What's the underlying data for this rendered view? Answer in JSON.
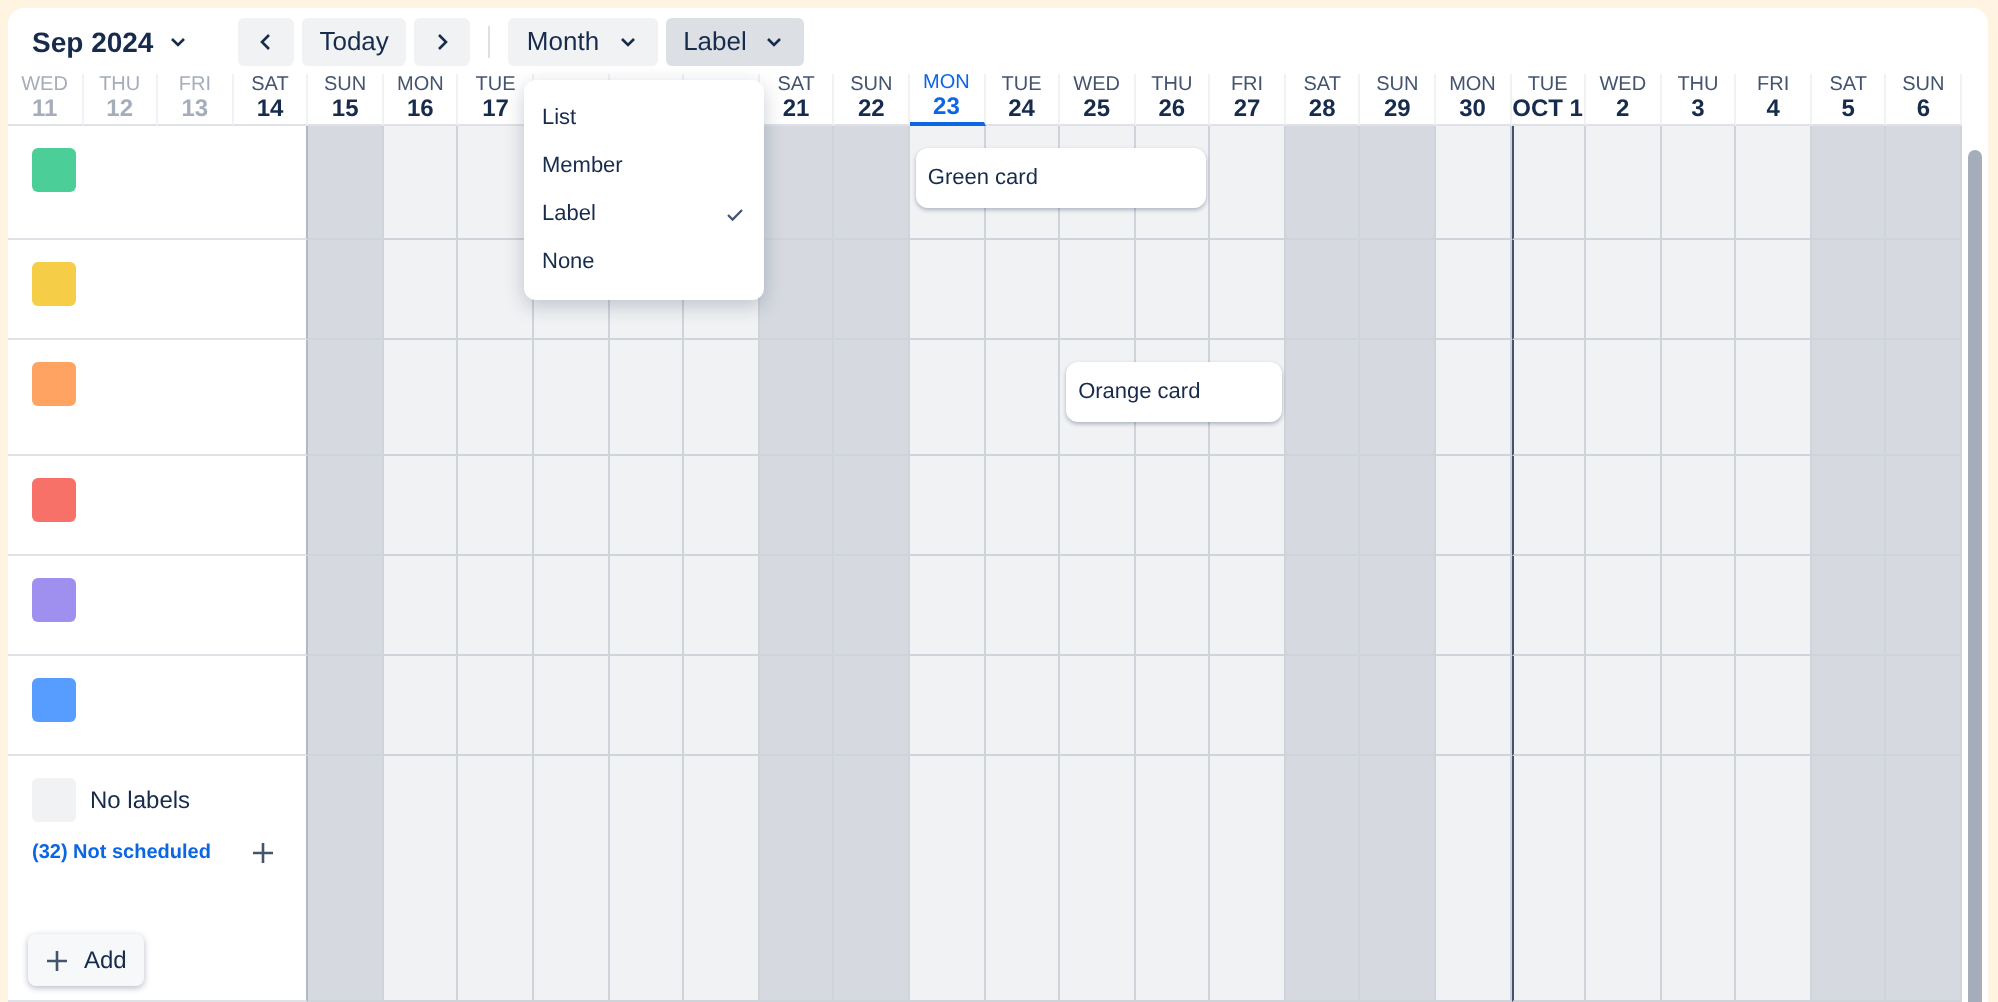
{
  "toolbar": {
    "period": "Sep 2024",
    "today": "Today",
    "view": "Month",
    "group_by": "Label",
    "group_by_open": true
  },
  "days": [
    {
      "dow": "WED",
      "date": "11",
      "dimmed": true,
      "today": false
    },
    {
      "dow": "THU",
      "date": "12",
      "dimmed": true,
      "today": false
    },
    {
      "dow": "FRI",
      "date": "13",
      "dimmed": true,
      "today": false
    },
    {
      "dow": "SAT",
      "date": "14",
      "dimmed": false,
      "today": false
    },
    {
      "dow": "SUN",
      "date": "15",
      "dimmed": false,
      "weekend": true,
      "today": false,
      "month_start": false
    },
    {
      "dow": "MON",
      "date": "16",
      "dimmed": false,
      "weekend": false,
      "today": false,
      "month_start": false
    },
    {
      "dow": "TUE",
      "date": "17",
      "dimmed": false,
      "weekend": false,
      "today": false,
      "month_start": false
    },
    {
      "weekend": false,
      "month_start": false
    },
    {
      "weekend": false,
      "month_start": false
    },
    {
      "weekend": false,
      "month_start": false
    },
    {
      "dow": "SAT",
      "date": "21",
      "dimmed": false,
      "weekend": true,
      "today": false,
      "month_start": false
    },
    {
      "dow": "SUN",
      "date": "22",
      "dimmed": false,
      "weekend": true,
      "today": false,
      "month_start": false
    },
    {
      "dow": "MON",
      "date": "23",
      "dimmed": false,
      "weekend": false,
      "today": true,
      "month_start": false
    },
    {
      "dow": "TUE",
      "date": "24",
      "dimmed": false,
      "weekend": false,
      "today": false,
      "month_start": false
    },
    {
      "dow": "WED",
      "date": "25",
      "dimmed": false,
      "weekend": false,
      "today": false,
      "month_start": false
    },
    {
      "dow": "THU",
      "date": "26",
      "dimmed": false,
      "weekend": false,
      "today": false,
      "month_start": false
    },
    {
      "dow": "FRI",
      "date": "27",
      "dimmed": false,
      "weekend": false,
      "today": false,
      "month_start": false
    },
    {
      "dow": "SAT",
      "date": "28",
      "dimmed": false,
      "weekend": true,
      "today": false,
      "month_start": false
    },
    {
      "dow": "SUN",
      "date": "29",
      "dimmed": false,
      "weekend": true,
      "today": false,
      "month_start": false
    },
    {
      "dow": "MON",
      "date": "30",
      "dimmed": false,
      "weekend": false,
      "today": false,
      "month_start": false
    },
    {
      "dow": "TUE",
      "date": "OCT 1",
      "dimmed": false,
      "weekend": false,
      "today": false,
      "month_start": true
    },
    {
      "dow": "WED",
      "date": "2",
      "dimmed": false,
      "weekend": false,
      "today": false,
      "month_start": false
    },
    {
      "dow": "THU",
      "date": "3",
      "dimmed": false,
      "weekend": false,
      "today": false,
      "month_start": false
    },
    {
      "dow": "FRI",
      "date": "4",
      "dimmed": false,
      "weekend": false,
      "today": false,
      "month_start": false
    },
    {
      "dow": "SAT",
      "date": "5",
      "dimmed": false,
      "weekend": true,
      "today": false,
      "month_start": false
    },
    {
      "dow": "SUN",
      "date": "6",
      "dimmed": false,
      "weekend": true,
      "today": false,
      "month_start": false
    }
  ],
  "lanes": [
    {
      "kind": "label",
      "color": "#4bce97",
      "cards": [
        "Green card"
      ]
    },
    {
      "kind": "label",
      "color": "#f5cd47"
    },
    {
      "kind": "label",
      "color": "#fea362",
      "cards": [
        "Orange card"
      ]
    },
    {
      "kind": "label",
      "color": "#f87168"
    },
    {
      "kind": "label",
      "color": "#9f8fef"
    },
    {
      "kind": "label",
      "color": "#579dff"
    },
    {
      "kind": "none",
      "name": "No labels",
      "unscheduled": "(32) Not scheduled"
    }
  ],
  "add_button": "Add",
  "menu": [
    {
      "label": "List",
      "selected": false
    },
    {
      "label": "Member",
      "selected": false
    },
    {
      "label": "Label",
      "selected": true
    },
    {
      "label": "None",
      "selected": false
    }
  ]
}
